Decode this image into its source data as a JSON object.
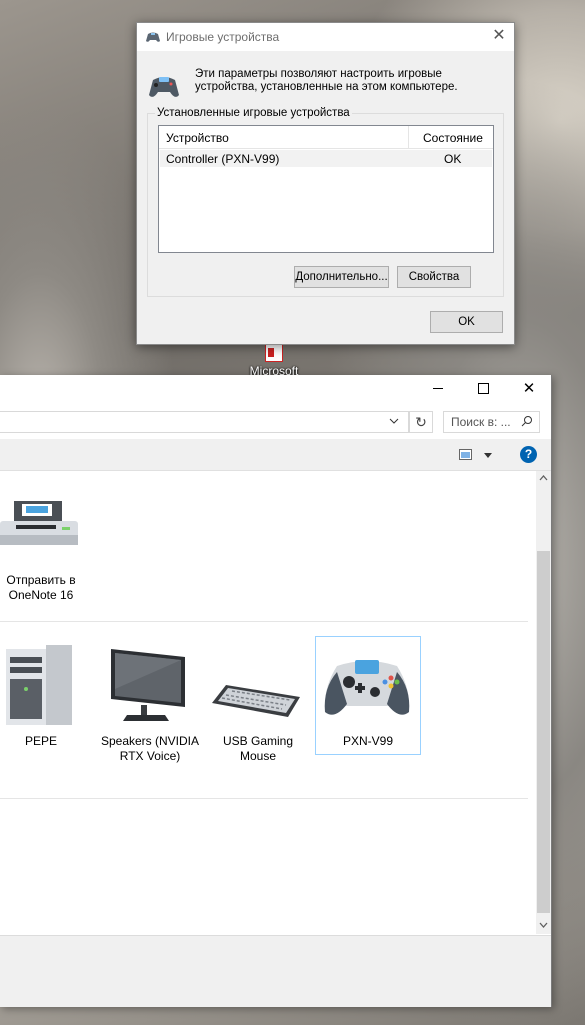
{
  "desktop": {
    "icon_label": "Microsoft"
  },
  "dialog": {
    "title": "Игровые устройства",
    "description": "Эти параметры позволяют настроить игровые устройства, установленные на этом компьютере.",
    "group_label": "Установленные игровые устройства",
    "columns": [
      "Устройство",
      "Состояние"
    ],
    "rows": [
      {
        "device": "Controller (PXN-V99)",
        "status": "OK"
      }
    ],
    "advanced_button": "Дополнительно...",
    "properties_button": "Свойства",
    "ok_button": "OK"
  },
  "explorer": {
    "search_placeholder": "Поиск в: ...",
    "printers": [
      {
        "label": "Отправить в OneNote 16"
      }
    ],
    "devices": [
      {
        "label": "PEPE"
      },
      {
        "label": "Speakers (NVIDIA RTX Voice)"
      },
      {
        "label": "USB Gaming Mouse"
      },
      {
        "label": "PXN-V99"
      }
    ],
    "colors": {
      "help_blue": "#0063b1",
      "selection_border": "#99d1ff"
    }
  }
}
